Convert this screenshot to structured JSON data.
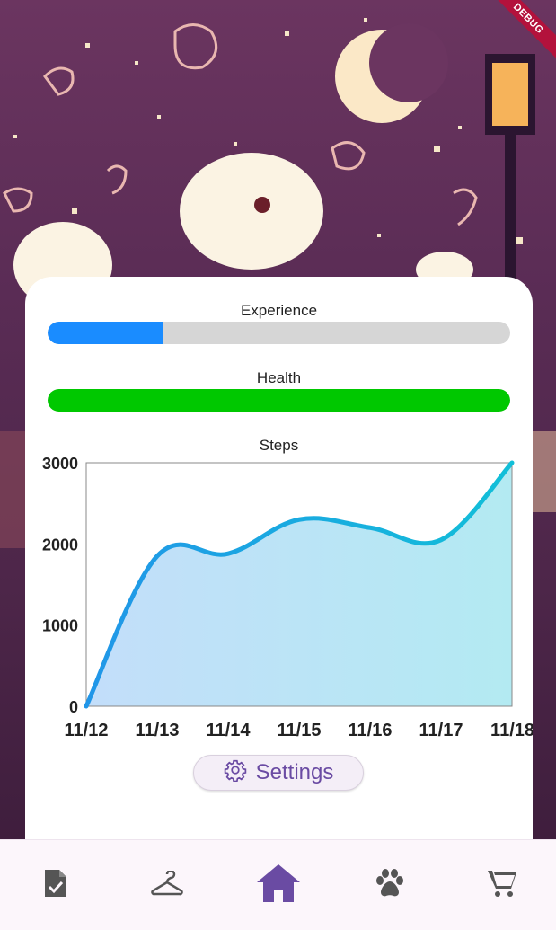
{
  "debug_banner": "DEBUG",
  "stats": {
    "experience": {
      "label": "Experience",
      "value": 0.25,
      "color": "#1a8cff"
    },
    "health": {
      "label": "Health",
      "value": 1.0,
      "color": "#00c800"
    }
  },
  "chart_data": {
    "type": "area",
    "title": "Steps",
    "xlabel": "",
    "ylabel": "",
    "categories": [
      "11/12",
      "11/13",
      "11/14",
      "11/15",
      "11/16",
      "11/17",
      "11/18"
    ],
    "values": [
      0,
      1850,
      1880,
      2300,
      2200,
      2050,
      3000
    ],
    "ylim": [
      0,
      3000
    ],
    "yticks": [
      "3000",
      "2000",
      "1000",
      "0"
    ],
    "line_color": "#1ea8e0",
    "grid": false
  },
  "settings_button": {
    "label": "Settings",
    "icon": "gear-icon"
  },
  "bottom_nav": {
    "items": [
      {
        "name": "tasks",
        "icon": "clipboard-check-icon",
        "active": false
      },
      {
        "name": "wardrobe",
        "icon": "hanger-icon",
        "active": false
      },
      {
        "name": "home",
        "icon": "home-icon",
        "active": true
      },
      {
        "name": "pets",
        "icon": "paw-icon",
        "active": false
      },
      {
        "name": "shop",
        "icon": "cart-icon",
        "active": false
      }
    ],
    "active_color": "#6a4ba3",
    "inactive_color": "#555555"
  }
}
